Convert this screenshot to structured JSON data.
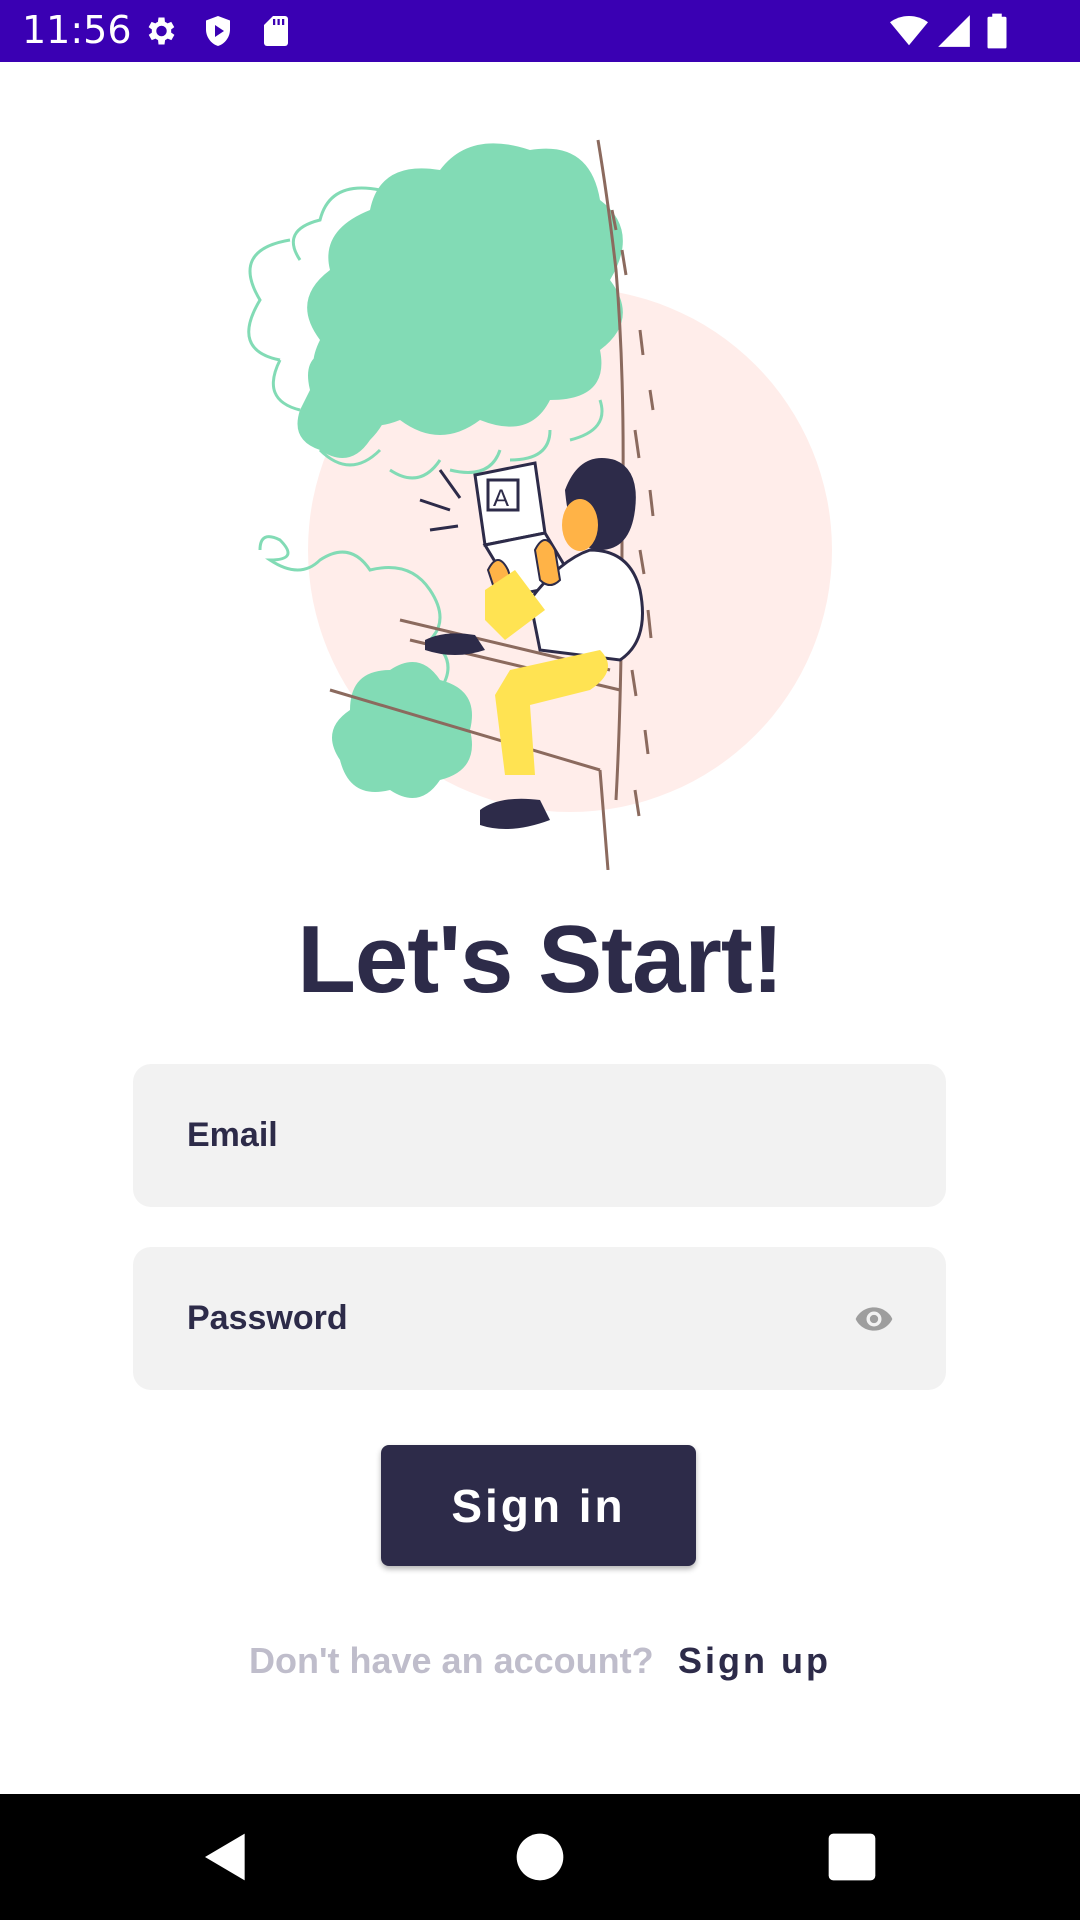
{
  "status_bar": {
    "time": "11:56",
    "background": "#3A00B3",
    "icons": [
      "settings-icon",
      "shield-play-icon",
      "sd-card-icon",
      "wifi-icon",
      "signal-icon",
      "battery-icon"
    ]
  },
  "title": "Let's Start!",
  "form": {
    "email_placeholder": "Email",
    "password_placeholder": "Password",
    "password_toggle_icon": "eye-icon",
    "signin_label": "Sign in"
  },
  "footer": {
    "question": "Don't have an account?",
    "signup_label": "Sign up"
  },
  "nav_bar": {
    "icons": [
      "back-icon",
      "home-icon",
      "recents-icon"
    ]
  },
  "colors": {
    "primary": "#2D2B49",
    "field_bg": "#F2F2F2",
    "muted_text": "#BFBDCB",
    "accent_green": "#82DBB5",
    "accent_yellow": "#FFE352",
    "accent_pink": "#FFEDEA"
  }
}
